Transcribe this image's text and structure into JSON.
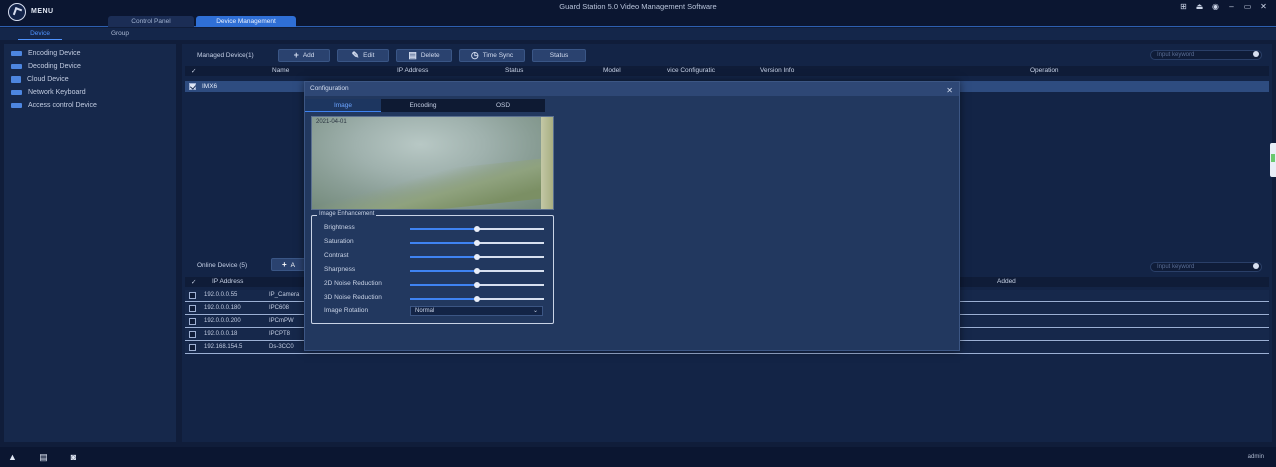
{
  "app": {
    "menu_label": "MENU",
    "title": "Guard Station 5.0 Video Management Software",
    "window_controls": [
      "⊞",
      "⏏",
      "◉",
      "–",
      "▭",
      "✕"
    ]
  },
  "main_tabs": [
    {
      "label": "Control Panel",
      "active": false
    },
    {
      "label": "Device Management",
      "active": true
    }
  ],
  "sub_tabs": [
    {
      "label": "Device",
      "active": true
    },
    {
      "label": "Group",
      "active": false
    }
  ],
  "sidebar": {
    "items": [
      {
        "label": "Encoding Device",
        "icon": "encoder-device-icon"
      },
      {
        "label": "Decoding Device",
        "icon": "decoder-device-icon"
      },
      {
        "label": "Cloud Device",
        "icon": "cloud-device-icon"
      },
      {
        "label": "Network Keyboard",
        "icon": "keyboard-device-icon"
      },
      {
        "label": "Access control Device",
        "icon": "access-control-device-icon"
      }
    ]
  },
  "managed": {
    "label": "Managed Device(1)",
    "buttons": {
      "add": "Add",
      "edit": "Edit",
      "delete": "Delete",
      "timesync": "Time Sync",
      "status": "Status"
    },
    "search_placeholder": "Input keyword",
    "columns": {
      "name": "Name",
      "ip": "IP Address",
      "status": "Status",
      "model": "Model",
      "config": "vice Configuratic",
      "version": "Version Info",
      "operation": "Operation"
    },
    "rows": [
      {
        "name": "IMX6",
        "checked": true
      }
    ]
  },
  "online": {
    "label": "Online Device (5)",
    "add_label": "A",
    "search_placeholder": "Input keyword",
    "columns": {
      "ip": "IP Address",
      "added": "Added"
    },
    "rows": [
      {
        "ip": "192.0.0.0.55",
        "name": "IP_Camera"
      },
      {
        "ip": "192.0.0.0.180",
        "name": "IPC608"
      },
      {
        "ip": "192.0.0.0.200",
        "name": "IPCmPW"
      },
      {
        "ip": "192.0.0.0.18",
        "name": "IPCPT8"
      },
      {
        "ip": "192.168.154.5",
        "name": "Ds-3CC0"
      }
    ]
  },
  "dialog": {
    "title": "Configuration",
    "close": "✕",
    "tabs": [
      {
        "label": "Image",
        "active": true
      },
      {
        "label": "Encoding",
        "active": false
      },
      {
        "label": "OSD",
        "active": false
      }
    ],
    "preview_label": "2021-04-01",
    "enhancement_title": "Image Enhancement",
    "sliders": [
      {
        "label": "Brightness",
        "value": 0.5
      },
      {
        "label": "Saturation",
        "value": 0.5
      },
      {
        "label": "Contrast",
        "value": 0.5
      },
      {
        "label": "Sharpness",
        "value": 0.5
      },
      {
        "label": "2D Noise Reduction",
        "value": 0.5
      },
      {
        "label": "3D Noise Reduction",
        "value": 0.5
      }
    ],
    "rotation_label": "Image Rotation",
    "rotation_value": "Normal"
  },
  "statusbar": {
    "user": "admin"
  },
  "colors": {
    "accent": "#3f83f2",
    "background": "#101d3a",
    "panel": "#16284b"
  }
}
